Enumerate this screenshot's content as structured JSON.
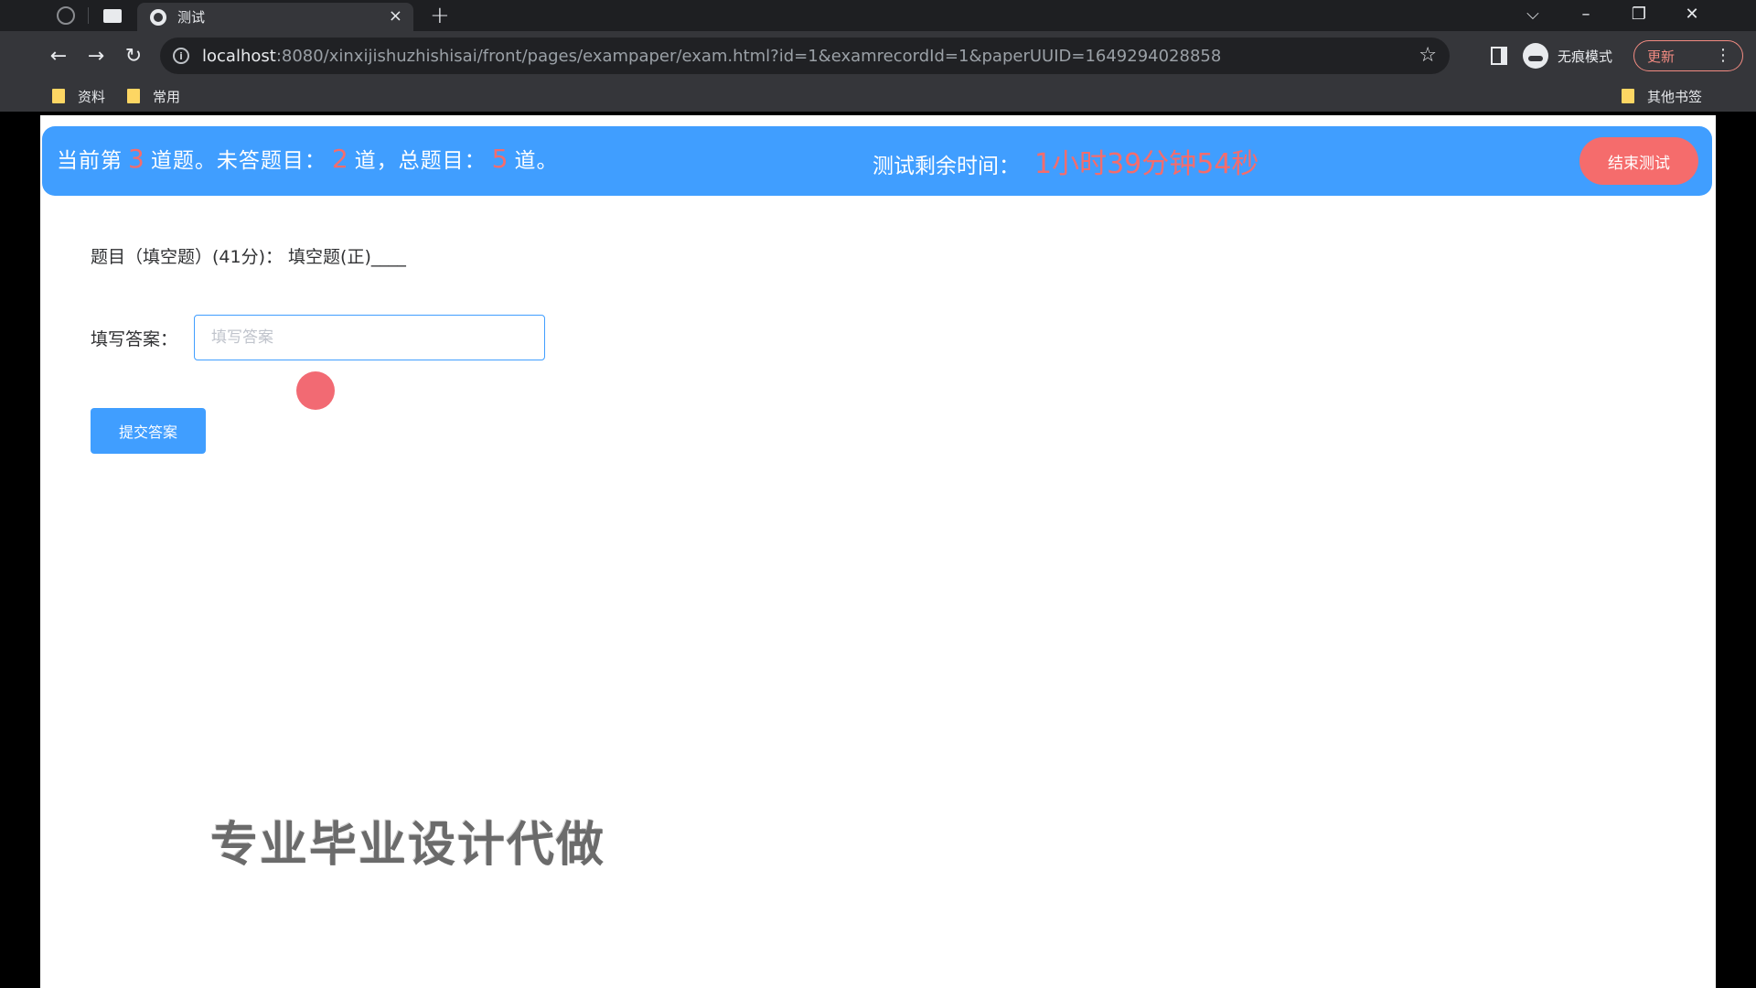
{
  "browser": {
    "tab_title": "测试",
    "tab_close": "×",
    "new_tab": "+",
    "window_controls": {
      "dropdown": "⌵",
      "minimize": "–",
      "restore": "❐",
      "close": "✕"
    },
    "nav": {
      "back": "←",
      "forward": "→",
      "reload": "↻"
    },
    "url_host": "localhost",
    "url_rest": ":8080/xinxijishuzhishisai/front/pages/exampaper/exam.html?id=1&examrecordId=1&paperUUID=1649294028858",
    "incognito_label": "无痕模式",
    "update_label": "更新",
    "bookmarks": [
      "资料",
      "常用"
    ],
    "other_bookmarks": "其他书签"
  },
  "exam_header": {
    "prefix": "当前第",
    "current_index": "3",
    "mid1": "道题。未答题目：",
    "unanswered": "2",
    "mid2": "道，总题目：",
    "total": "5",
    "suffix": "道。",
    "timer_label": "测试剩余时间：",
    "timer_value": "1小时39分钟54秒",
    "end_button": "结束测试"
  },
  "question": {
    "text": "题目（填空题）(41分)：  填空题(正)____"
  },
  "answer": {
    "label": "填写答案：",
    "placeholder": "填写答案",
    "value": ""
  },
  "submit_button": "提交答案",
  "watermark": "专业毕业设计代做",
  "colors": {
    "primary": "#409eff",
    "danger": "#f56c6c"
  }
}
